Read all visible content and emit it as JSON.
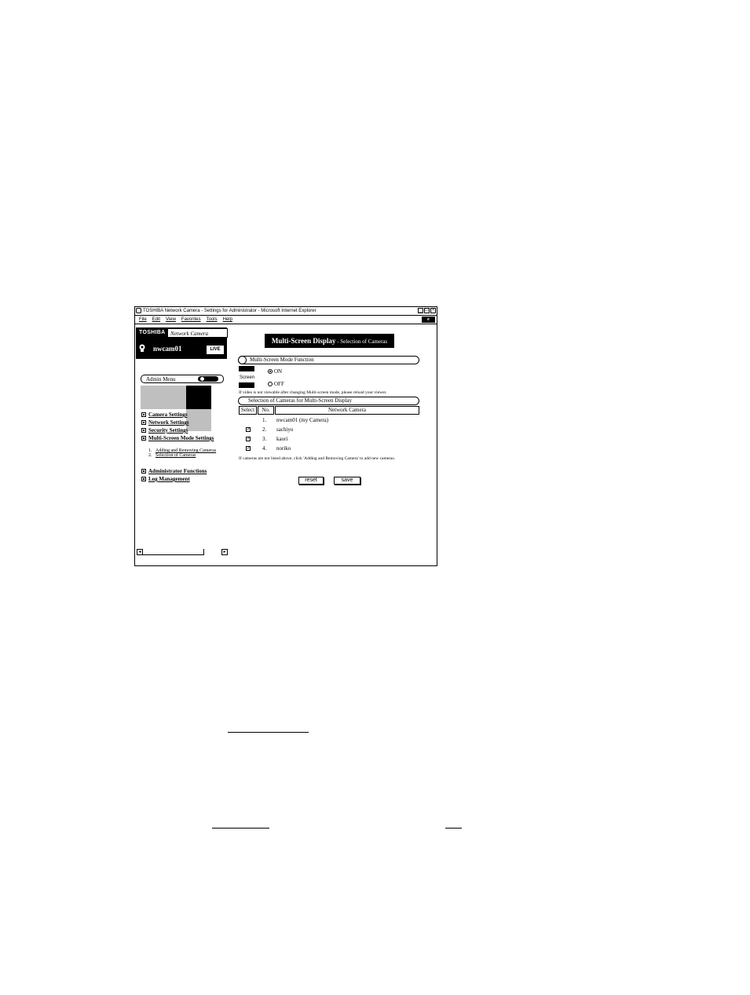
{
  "window": {
    "title": "TOSHIBA Network Camera - Settings for Administrator - Microsoft Internet Explorer",
    "menu": [
      "File",
      "Edit",
      "View",
      "Favorites",
      "Tools",
      "Help"
    ],
    "controls": {
      "minimize": "_",
      "maximize": "□",
      "close": "×"
    }
  },
  "brand": {
    "logo": "TOSHIBA",
    "product": "Network Camera",
    "camera_name": "nwcam01",
    "live_label": "LIVE"
  },
  "sidebar": {
    "admin_menu_label": "Admin Menu",
    "items_top": [
      "Camera Settings",
      "Network Settings",
      "Security Settings",
      "Multi-Screen Mode Settings"
    ],
    "sub_items": [
      {
        "num": "1.",
        "label": "Adding and Removing Cameras"
      },
      {
        "num": "2.",
        "label": "Selection of Cameras"
      }
    ],
    "items_bottom": [
      "Administrator Functions",
      "Log Management"
    ],
    "scroll_left": "◂",
    "scroll_right": "▸"
  },
  "main": {
    "title_bold": "Multi-Screen Display",
    "title_rest": " - Selection of Cameras",
    "section1": {
      "heading": "Multi-Screen Mode Function",
      "label": "Screen",
      "options": [
        {
          "label": "ON",
          "selected": true
        },
        {
          "label": "OFF",
          "selected": false
        }
      ],
      "note": "If video is not viewable after changing Multi-screen mode, please reload your viewer."
    },
    "section2": {
      "heading": "Selection of Cameras for Multi-Screen Display",
      "columns": [
        "Select",
        "No.",
        "Network Camera"
      ],
      "rows": [
        {
          "checked": false,
          "no": "1.",
          "name": "nwcam01   (my Camera)"
        },
        {
          "checked": true,
          "no": "2.",
          "name": "sachiyo"
        },
        {
          "checked": true,
          "no": "3.",
          "name": "kaori"
        },
        {
          "checked": true,
          "no": "4.",
          "name": "noriko"
        }
      ],
      "note": "If cameras are not listed above, click 'Adding and Removing Camera' to add new cameras."
    },
    "buttons": {
      "reset": "reset",
      "save": "save"
    }
  }
}
